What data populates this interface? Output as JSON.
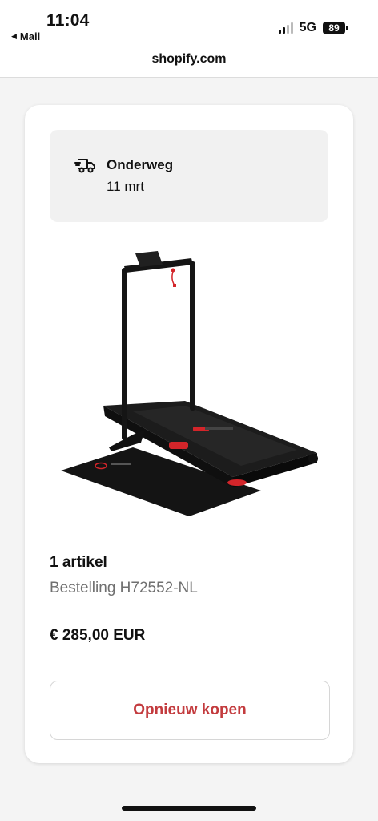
{
  "status_bar": {
    "time": "11:04",
    "back_app": "Mail",
    "network": "5G",
    "battery": "89"
  },
  "url_bar": {
    "domain": "shopify.com"
  },
  "order": {
    "shipment_status": "Onderweg",
    "shipment_date": "11 mrt",
    "item_count": "1 artikel",
    "order_number": "Bestelling H72552-NL",
    "price": "€ 285,00 EUR",
    "buy_again_label": "Opnieuw kopen"
  },
  "icons": {
    "shipping": "delivery-truck-icon",
    "back": "back-triangle-icon"
  },
  "colors": {
    "accent": "#c33b3e",
    "secondary_text": "#707070",
    "shipment_bg": "#f1f1f1"
  }
}
